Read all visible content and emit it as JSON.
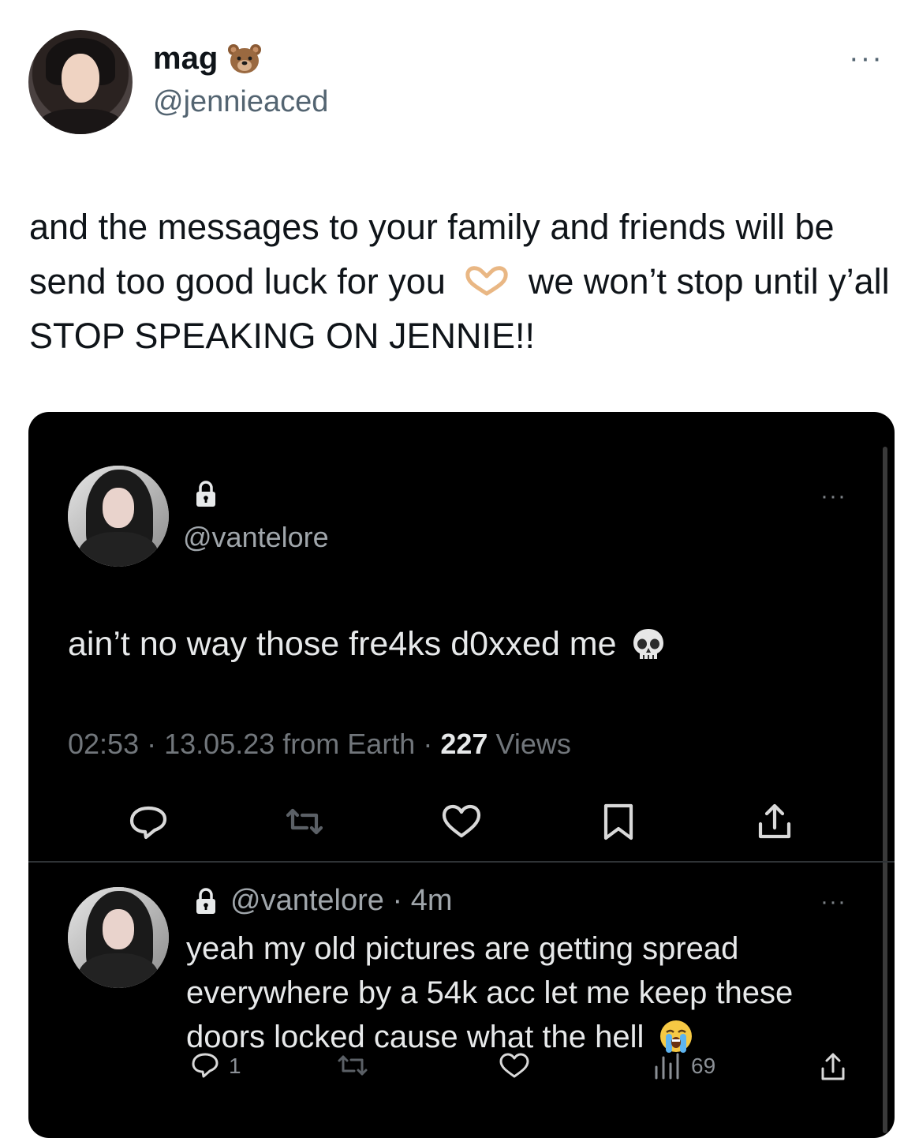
{
  "author": {
    "name": "mag",
    "name_emoji": "bear-face",
    "handle": "@jennieaced",
    "more_label": "···"
  },
  "tweet": {
    "text_part1": "and the messages to your family and friends will be send too good luck for you",
    "text_emoji": "heart-hands",
    "text_part2": "we won’t stop until y’all STOP SPEAKING ON JENNIE!!"
  },
  "embedded": {
    "theme_bg": "#000000",
    "post": {
      "handle": "@vantelore",
      "locked": true,
      "more_label": "···",
      "text": "ain’t no way those fre4ks d0xxed me",
      "text_emoji": "skull",
      "time": "02:53",
      "sep1": "·",
      "date": "13.05.23",
      "source": "from Earth",
      "sep2": "·",
      "views_count": "227",
      "views_label": "Views",
      "actions": [
        "reply-icon",
        "retweet-icon",
        "like-icon",
        "bookmark-icon",
        "share-icon"
      ]
    },
    "reply": {
      "handle": "@vantelore",
      "sep": "·",
      "age": "4m",
      "locked": true,
      "more_label": "···",
      "text": "yeah my old pictures are getting spread everywhere by a 54k acc let me keep these doors locked cause what the hell",
      "text_emoji": "loudly-crying-face",
      "reply_count": "1",
      "views_count": "69"
    }
  }
}
